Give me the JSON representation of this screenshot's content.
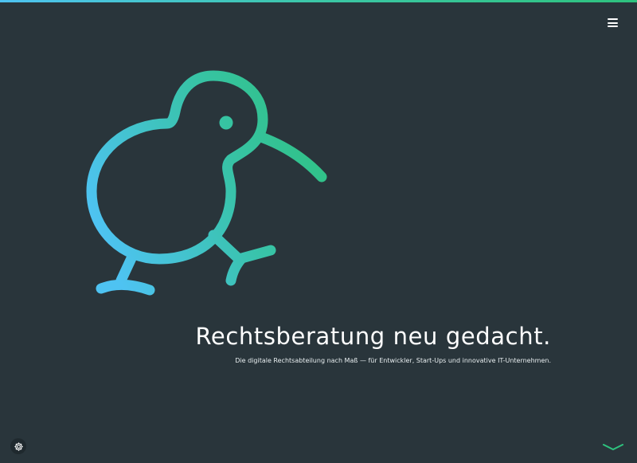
{
  "hero": {
    "headline": "Rechtsberatung neu gedacht.",
    "subline": "Die digitale Rechtsabteilung nach Maß — für Entwickler, Start-Ups und innovative IT-Unternehmen."
  },
  "icons": {
    "menu": "hamburger-menu-icon",
    "logo": "kiwi-bird-logo",
    "settings": "gear-icon",
    "scroll": "chevron-down-icon"
  },
  "colors": {
    "background": "#29353b",
    "gradient_start": "#4ec3f2",
    "gradient_end": "#2ec27e",
    "text": "#ffffff"
  }
}
